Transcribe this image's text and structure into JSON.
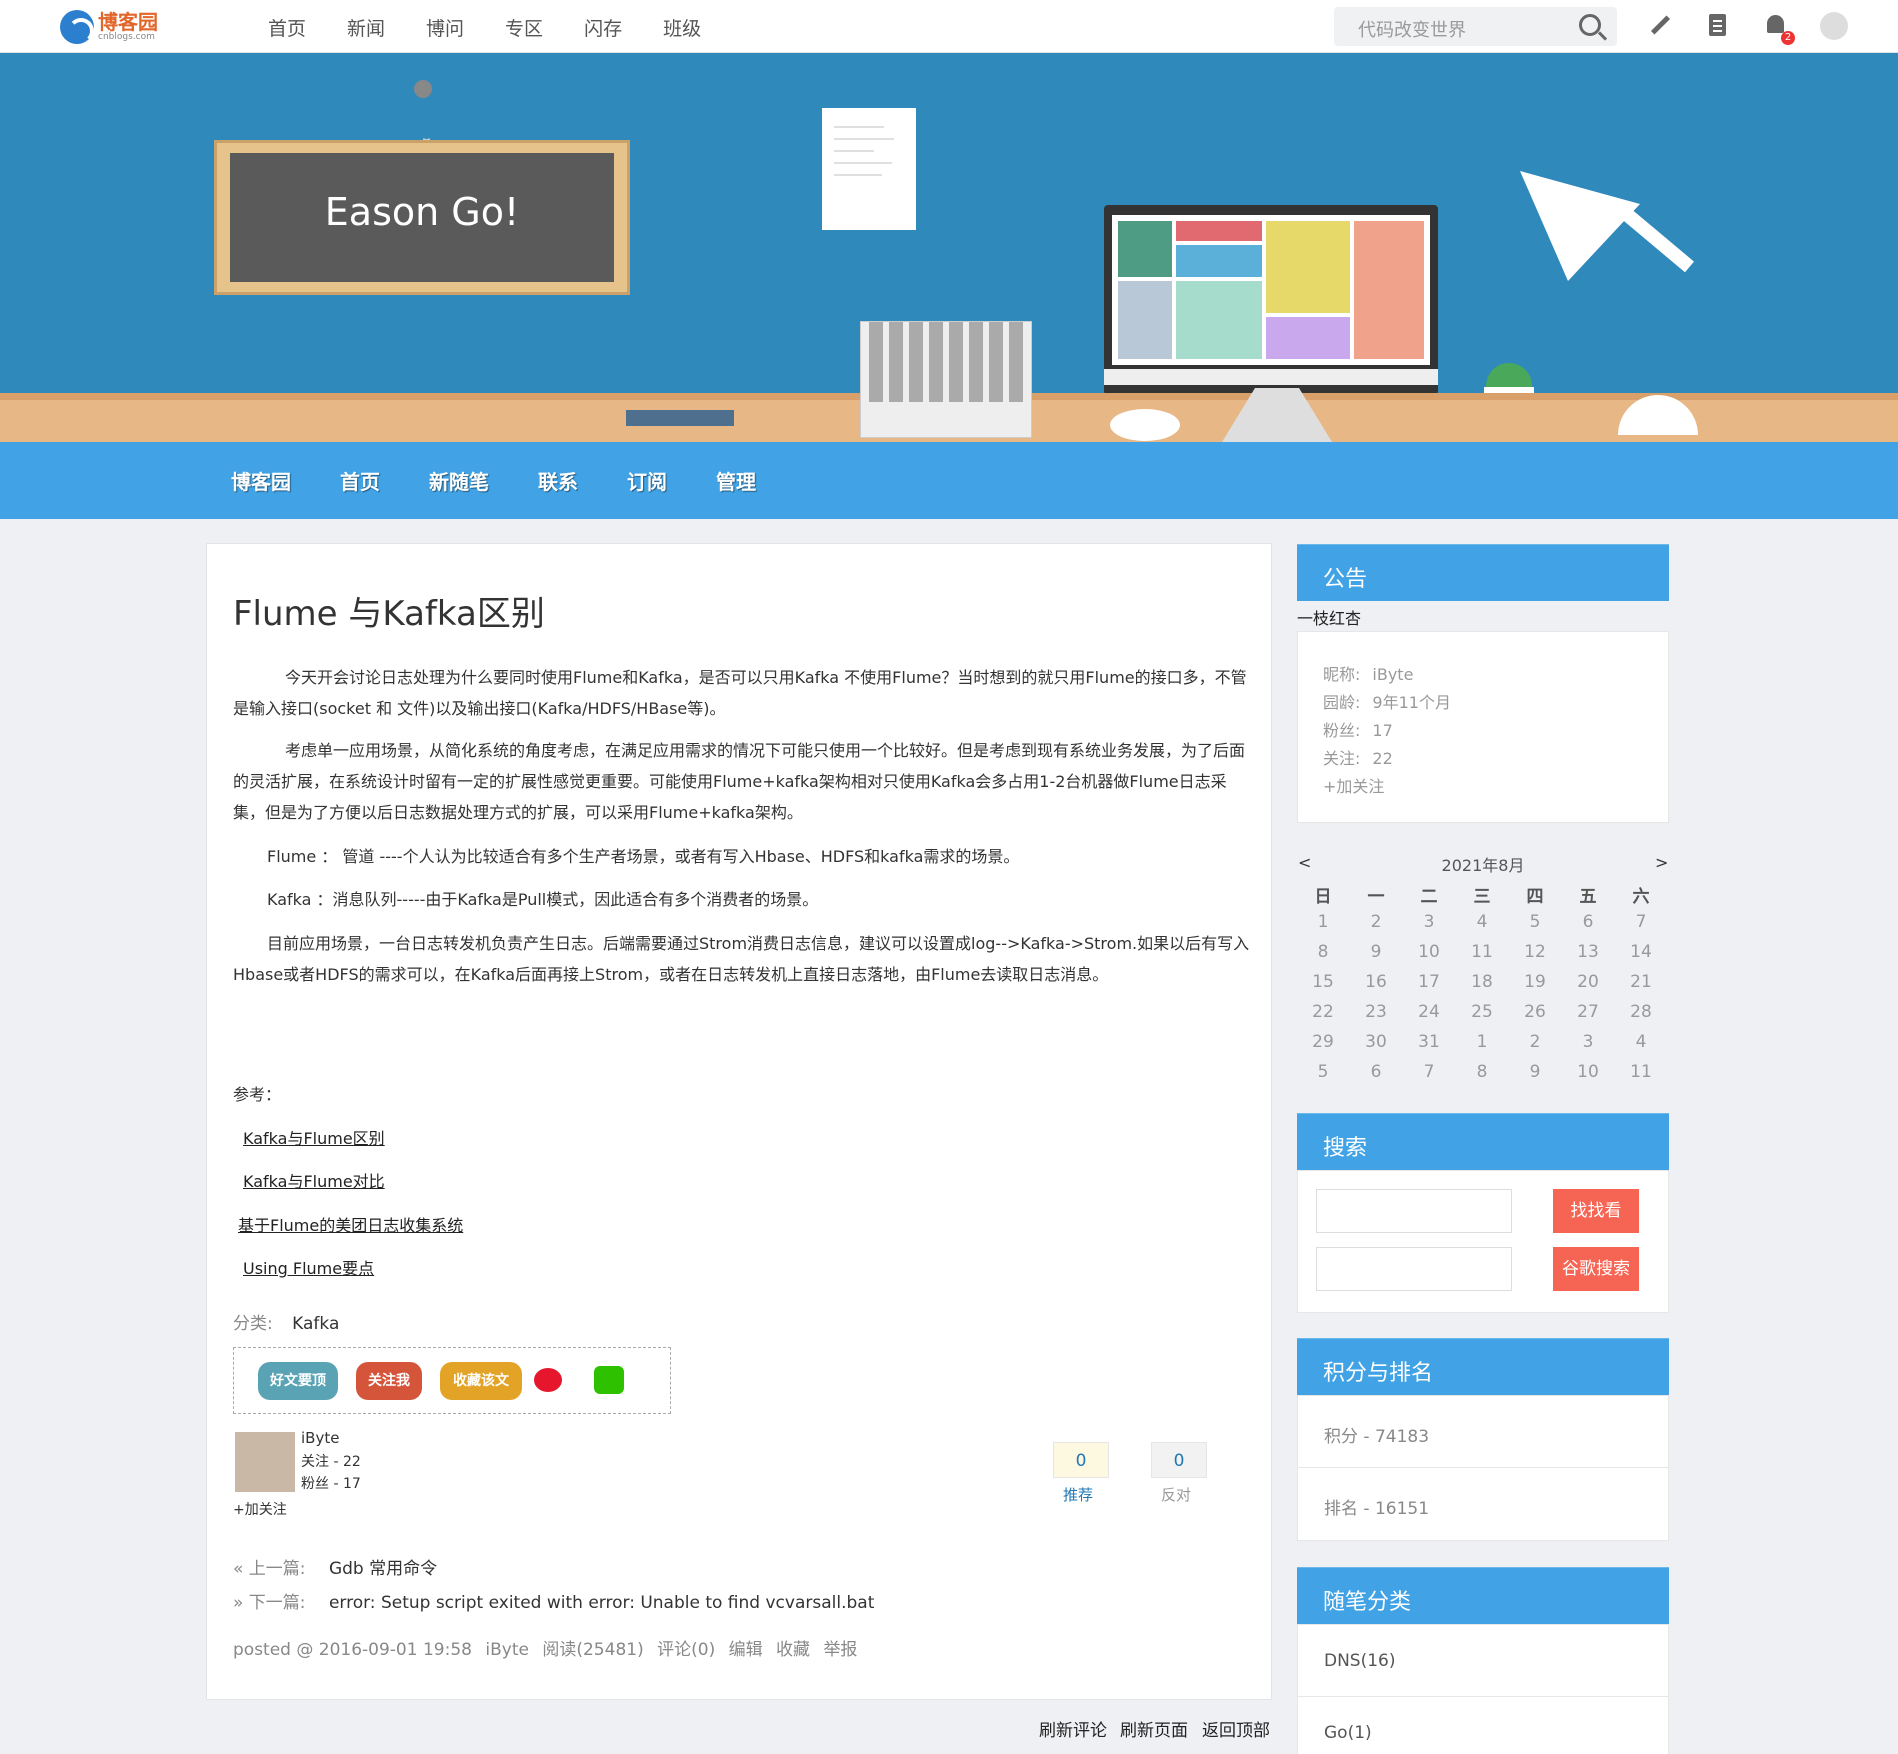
{
  "site": {
    "logo_title": "博客园",
    "logo_sub": "cnblogs.com",
    "nav": [
      "首页",
      "新闻",
      "博问",
      "专区",
      "闪存",
      "班级"
    ],
    "search_placeholder": "代码改变世界",
    "notification_count": "2"
  },
  "banner": {
    "board_text": "Eason Go!"
  },
  "blog_menu": [
    "博客园",
    "首页",
    "新随笔",
    "联系",
    "订阅",
    "管理"
  ],
  "post": {
    "title": "Flume 与Kafka区别",
    "paragraphs": [
      "今天开会讨论日志处理为什么要同时使用Flume和Kafka，是否可以只用Kafka 不使用Flume？当时想到的就只用Flume的接口多，不管是输入接口(socket 和 文件)以及输出接口(Kafka/HDFS/HBase等)。",
      "考虑单一应用场景，从简化系统的角度考虑，在满足应用需求的情况下可能只使用一个比较好。但是考虑到现有系统业务发展，为了后面的灵活扩展，在系统设计时留有一定的扩展性感觉更重要。可能使用Flume+kafka架构相对只使用Kafka会多占用1-2台机器做Flume日志采集，但是为了方便以后日志数据处理方式的扩展，可以采用Flume+kafka架构。",
      "Flume ： 管道 ----个人认为比较适合有多个生产者场景，或者有写入Hbase、HDFS和kafka需求的场景。",
      "Kafka ：消息队列-----由于Kafka是Pull模式，因此适合有多个消费者的场景。",
      "目前应用场景，一台日志转发机负责产生日志。后端需要通过Strom消费日志信息，建议可以设置成log-->Kafka->Strom.如果以后有写入Hbase或者HDFS的需求可以，在Kafka后面再接上Strom，或者在日志转发机上直接日志落地，由Flume去读取日志消息。"
    ],
    "ref_label": "参考：",
    "refs": [
      "Kafka与Flume区别",
      "Kafka与Flume对比",
      "基于Flume的美团日志收集系统",
      "Using Flume要点"
    ],
    "category_label": "分类:",
    "category": "Kafka",
    "share": {
      "good": "好文要顶",
      "follow": "关注我",
      "favorite": "收藏该文"
    },
    "author": {
      "name": "iByte",
      "following": "关注 - 22",
      "followers": "粉丝 - 17",
      "add_follow": "+加关注"
    },
    "votes": {
      "up_count": "0",
      "up_label": "推荐",
      "down_count": "0",
      "down_label": "反对"
    },
    "prev_label": "« 上一篇:",
    "prev_title": "Gdb 常用命令",
    "next_label": "» 下一篇:",
    "next_title": "error: Setup script exited with error: Unable to find vcvarsall.bat",
    "posted_prefix": "posted @ 2016-09-01 19:58",
    "posted_author": "iByte",
    "posted_reads": "阅读(25481)",
    "posted_comments": "评论(0)",
    "posted_edit": "编辑",
    "posted_fav": "收藏",
    "posted_report": "举报"
  },
  "below_post": [
    "刷新评论",
    "刷新页面",
    "返回顶部"
  ],
  "sidebar": {
    "notice_title": "公告",
    "notice_text": "一枝红杏",
    "profile": [
      {
        "label": "昵称:",
        "value": "iByte"
      },
      {
        "label": "园龄:",
        "value": "9年11个月"
      },
      {
        "label": "粉丝:",
        "value": "17"
      },
      {
        "label": "关注:",
        "value": "22"
      }
    ],
    "profile_follow": "+加关注",
    "calendar": {
      "title": "2021年8月",
      "prev": "<",
      "next": ">",
      "weekdays": [
        "日",
        "一",
        "二",
        "三",
        "四",
        "五",
        "六"
      ],
      "weeks": [
        [
          "1",
          "2",
          "3",
          "4",
          "5",
          "6",
          "7"
        ],
        [
          "8",
          "9",
          "10",
          "11",
          "12",
          "13",
          "14"
        ],
        [
          "15",
          "16",
          "17",
          "18",
          "19",
          "20",
          "21"
        ],
        [
          "22",
          "23",
          "24",
          "25",
          "26",
          "27",
          "28"
        ],
        [
          "29",
          "30",
          "31",
          "1",
          "2",
          "3",
          "4"
        ],
        [
          "5",
          "6",
          "7",
          "8",
          "9",
          "10",
          "11"
        ]
      ]
    },
    "search_title": "搜索",
    "search_btn": "找找看",
    "google_btn": "谷歌搜索",
    "rank_title": "积分与排名",
    "score": "积分 - 74183",
    "rank": "排名 - 16151",
    "cat_title": "随笔分类",
    "categories": [
      "DNS(16)",
      "Go(1)"
    ]
  },
  "colors": {
    "accent": "#41a3e6",
    "banner": "#2f89bb",
    "search_btn": "#f66454"
  }
}
